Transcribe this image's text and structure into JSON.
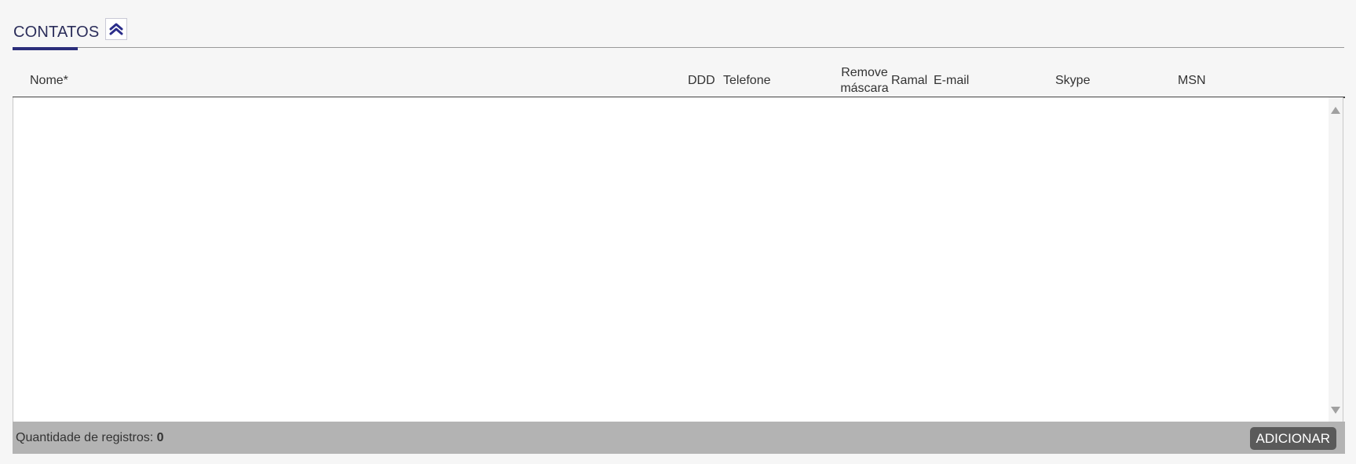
{
  "section": {
    "title": "CONTATOS",
    "collapse_icon": "double-chevron-up-icon"
  },
  "grid": {
    "columns": {
      "nome": "Nome*",
      "ddd": "DDD",
      "telefone": "Telefone",
      "remove_mascara_line1": "Remove",
      "remove_mascara_line2": "máscara",
      "ramal": "Ramal",
      "email": "E-mail",
      "skype": "Skype",
      "msn": "MSN"
    },
    "rows": []
  },
  "footer": {
    "records_label": "Quantidade de registros:",
    "records_count": "0",
    "add_label": "ADICIONAR"
  },
  "colors": {
    "accent": "#2b2d7a",
    "footer_bg": "#b3b3b3",
    "button_bg": "#5a5a5a"
  }
}
